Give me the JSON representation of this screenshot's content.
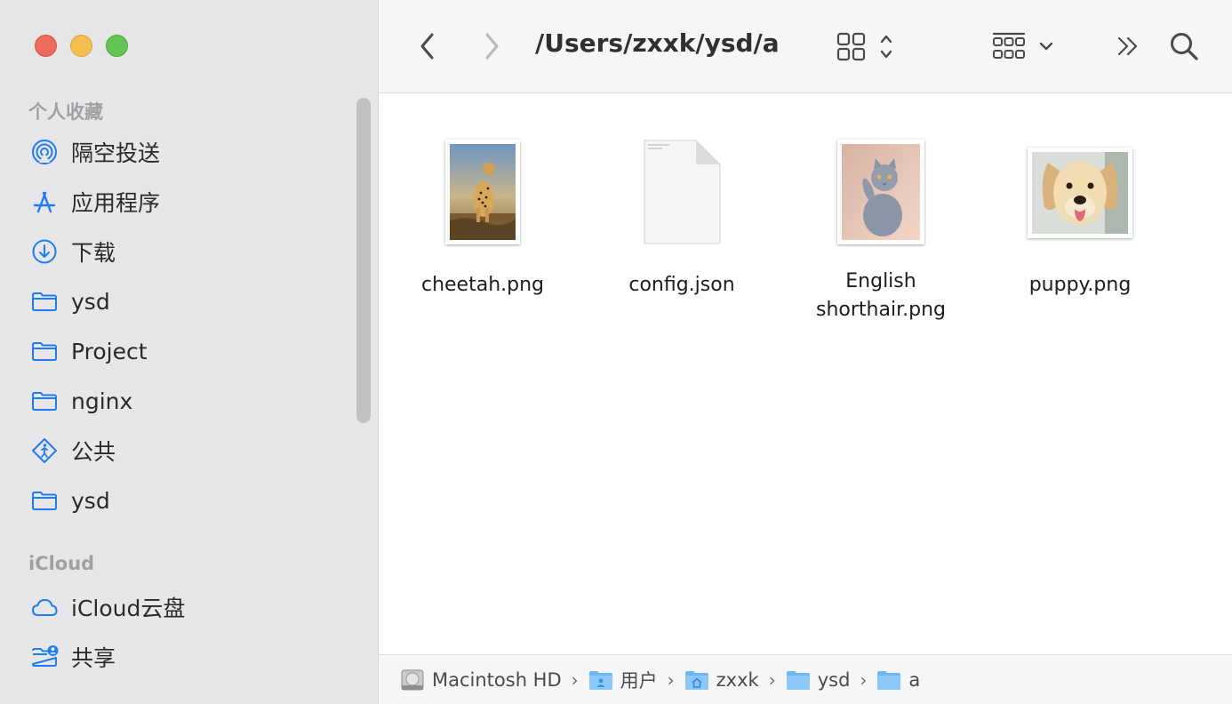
{
  "window": {
    "path_title": "/Users/zxxk/ysd/a"
  },
  "sidebar": {
    "favorites_title": "个人收藏",
    "favorites": [
      {
        "label": "隔空投送",
        "icon": "airdrop-icon"
      },
      {
        "label": "应用程序",
        "icon": "applications-icon"
      },
      {
        "label": "下载",
        "icon": "download-icon"
      },
      {
        "label": "ysd",
        "icon": "folder-icon"
      },
      {
        "label": "Project",
        "icon": "folder-icon"
      },
      {
        "label": "nginx",
        "icon": "folder-icon"
      },
      {
        "label": "公共",
        "icon": "public-icon"
      },
      {
        "label": "ysd",
        "icon": "folder-icon"
      }
    ],
    "icloud_title": "iCloud",
    "icloud": [
      {
        "label": "iCloud云盘",
        "icon": "cloud-icon"
      },
      {
        "label": "共享",
        "icon": "shared-folder-icon"
      }
    ]
  },
  "files": [
    {
      "name": "cheetah.png",
      "icon": "image-thumbnail-icon"
    },
    {
      "name": "config.json",
      "icon": "document-icon"
    },
    {
      "name_line1": "English",
      "name_line2": "shorthair.png",
      "icon": "image-thumbnail-icon"
    },
    {
      "name": "puppy.png",
      "icon": "image-thumbnail-icon"
    }
  ],
  "pathbar": [
    "Macintosh HD",
    "用户",
    "zxxk",
    "ysd",
    "a"
  ],
  "colors": {
    "accent": "#1f7cf2",
    "sidebar_bg": "#e7e7e9",
    "folder": "#6fb6f5"
  }
}
